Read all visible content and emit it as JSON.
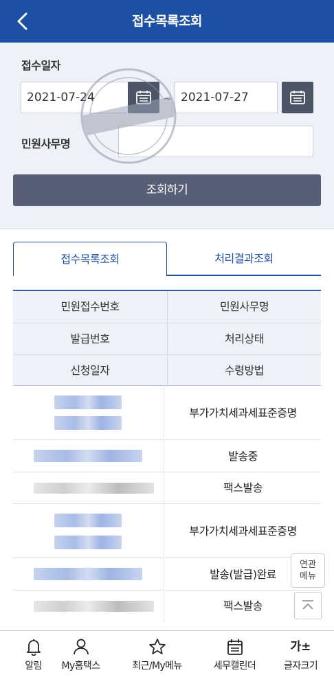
{
  "header": {
    "title": "접수목록조회"
  },
  "search": {
    "date_label": "접수일자",
    "start_date": "2021-07-24",
    "end_date": "2021-07-27",
    "separator": "~",
    "name_label": "민원사무명",
    "name_value": "",
    "search_button": "조회하기"
  },
  "tabs": [
    {
      "label": "접수목록조회",
      "active": true
    },
    {
      "label": "처리결과조회",
      "active": false
    }
  ],
  "table_headers": [
    [
      "민원접수번호",
      "민원사무명"
    ],
    [
      "발급번호",
      "처리상태"
    ],
    [
      "신청일자",
      "수령방법"
    ]
  ],
  "records": [
    {
      "name": "부가가치세과세표준증명",
      "status": "발송중",
      "delivery": "팩스발송"
    },
    {
      "name": "부가가치세과세표준증명",
      "status": "발송(발급)완료",
      "delivery": "팩스발송"
    }
  ],
  "floating": {
    "related_line1": "연관",
    "related_line2": "메뉴"
  },
  "bottom_nav": [
    {
      "label": "알림",
      "icon": "bell-icon"
    },
    {
      "label": "My홈택스",
      "icon": "person-icon"
    },
    {
      "label": "최근/My메뉴",
      "icon": "star-icon"
    },
    {
      "label": "세무캘린더",
      "icon": "calendar-icon"
    },
    {
      "label": "글자크기",
      "icon": "font-size-icon",
      "glyph": "가±"
    }
  ],
  "colors": {
    "primary": "#1d4fa3",
    "button": "#565f75",
    "panel": "#eff1f8"
  }
}
